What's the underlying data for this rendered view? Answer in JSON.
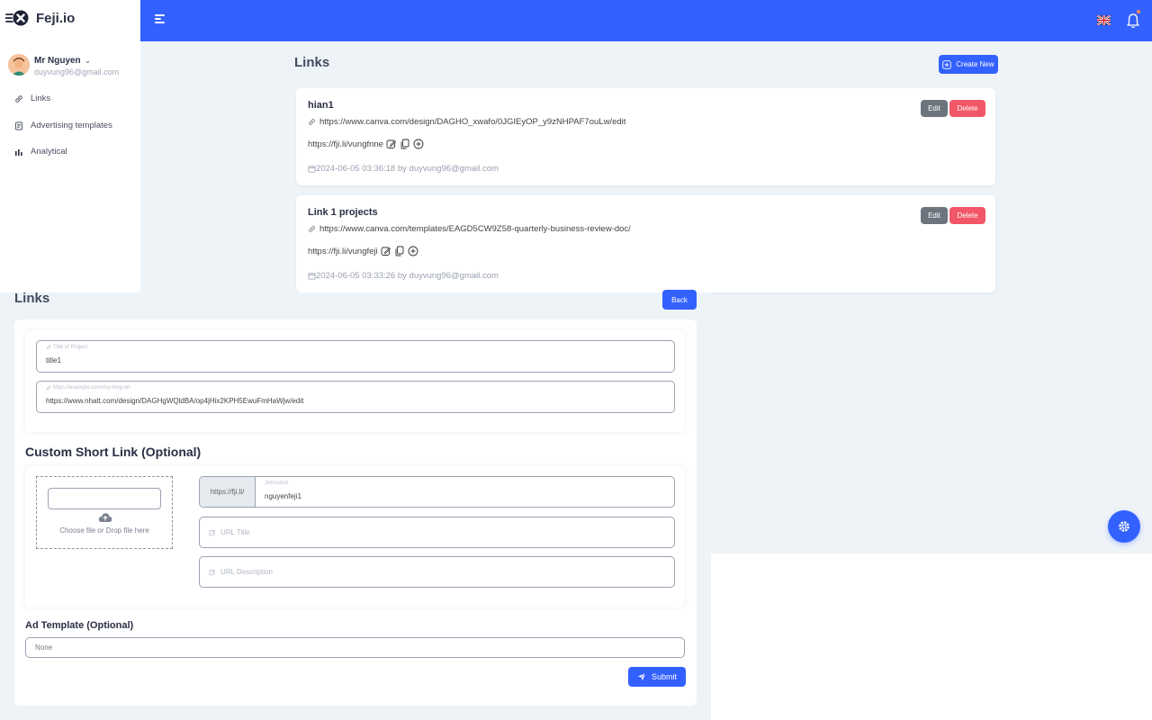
{
  "brand": {
    "name": "Feji.io"
  },
  "user": {
    "name": "Mr Nguyen",
    "email": "duyvung96@gmail.com"
  },
  "sidebar": {
    "items": [
      {
        "label": "Links",
        "icon": "link-icon"
      },
      {
        "label": "Advertising templates",
        "icon": "document-icon"
      },
      {
        "label": "Analytical",
        "icon": "bar-chart-icon"
      }
    ]
  },
  "links_page": {
    "title": "Links",
    "create_label": "Create New",
    "edit_label": "Edit",
    "delete_label": "Delete",
    "cards": [
      {
        "title": "hian1",
        "url": "https://www.canva.com/design/DAGHO_xwafo/0JGIEyOP_y9zNHPAF7ouLw/edit",
        "short": "https://fji.li/vungfnne",
        "date": "2024-06-05 03:36:18",
        "by": "by duyvung96@gmail.com"
      },
      {
        "title": "Link 1 projects",
        "url": "https://www.canva.com/templates/EAGD5CW9Z58-quarterly-business-review-doc/",
        "short": "https://fji.li/vungfeji",
        "date": "2024-06-05 03:33:26",
        "by": "by duyvung96@gmail.com"
      }
    ]
  },
  "form_page": {
    "title": "Links",
    "back_label": "Back",
    "title_field": {
      "label": "Title of Project",
      "value": "title1"
    },
    "url_field": {
      "label": "https://example.com/my-long-url",
      "value": "https://www.nhatt.com/design/DAGHgWQldBA/op4jHix2KPH5EwuFmHaWjw/edit"
    },
    "custom_section": "Custom Short Link (Optional)",
    "dropzone_text": "Choose file or Drop file here",
    "short_prefix": "https://fji.li/",
    "short_field": {
      "label": "Johnsand",
      "value": "nguyenfeji1"
    },
    "url_title_placeholder": "URL Title",
    "url_desc_placeholder": "URL Description",
    "ad_section": "Ad Template (Optional)",
    "ad_value": "None",
    "submit_label": "Submit"
  },
  "colors": {
    "primary": "#3361ff",
    "danger": "#f25767",
    "secondary": "#6c757d",
    "background": "#eef3f8"
  }
}
